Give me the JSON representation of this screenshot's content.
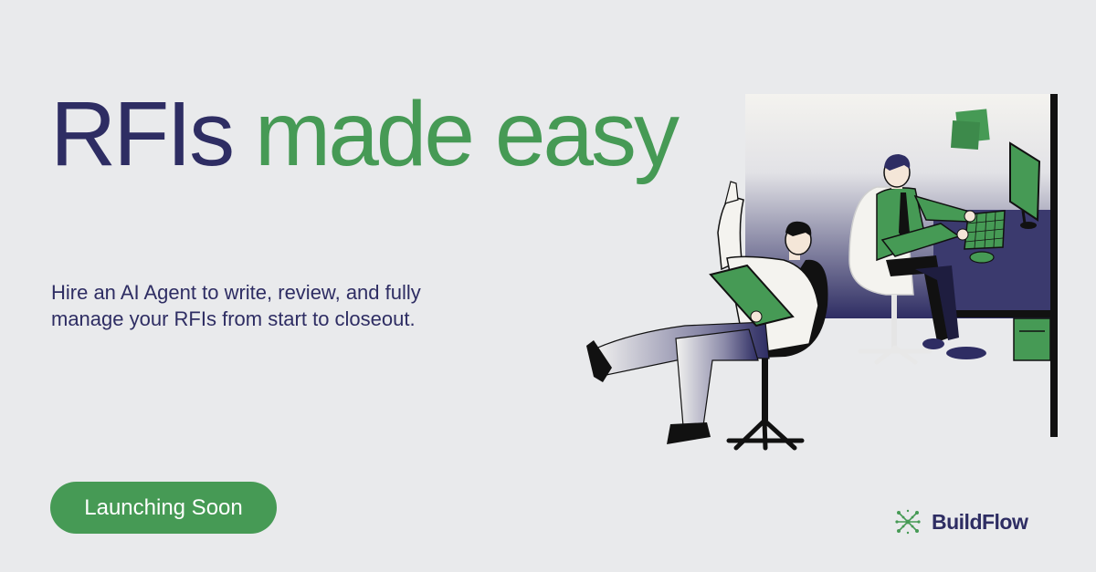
{
  "headline": {
    "part1": "RFIs",
    "part2": "made easy"
  },
  "subtitle": "Hire an AI Agent to write, review, and fully manage your RFIs from start to closeout.",
  "cta": {
    "label": "Launching Soon"
  },
  "brand": {
    "name": "BuildFlow",
    "logo_icon": "network-grid-icon"
  },
  "illustration": {
    "subject": "office-workers-illustration"
  },
  "colors": {
    "background": "#e9eaec",
    "navy": "#2e2d63",
    "green": "#469a55"
  }
}
